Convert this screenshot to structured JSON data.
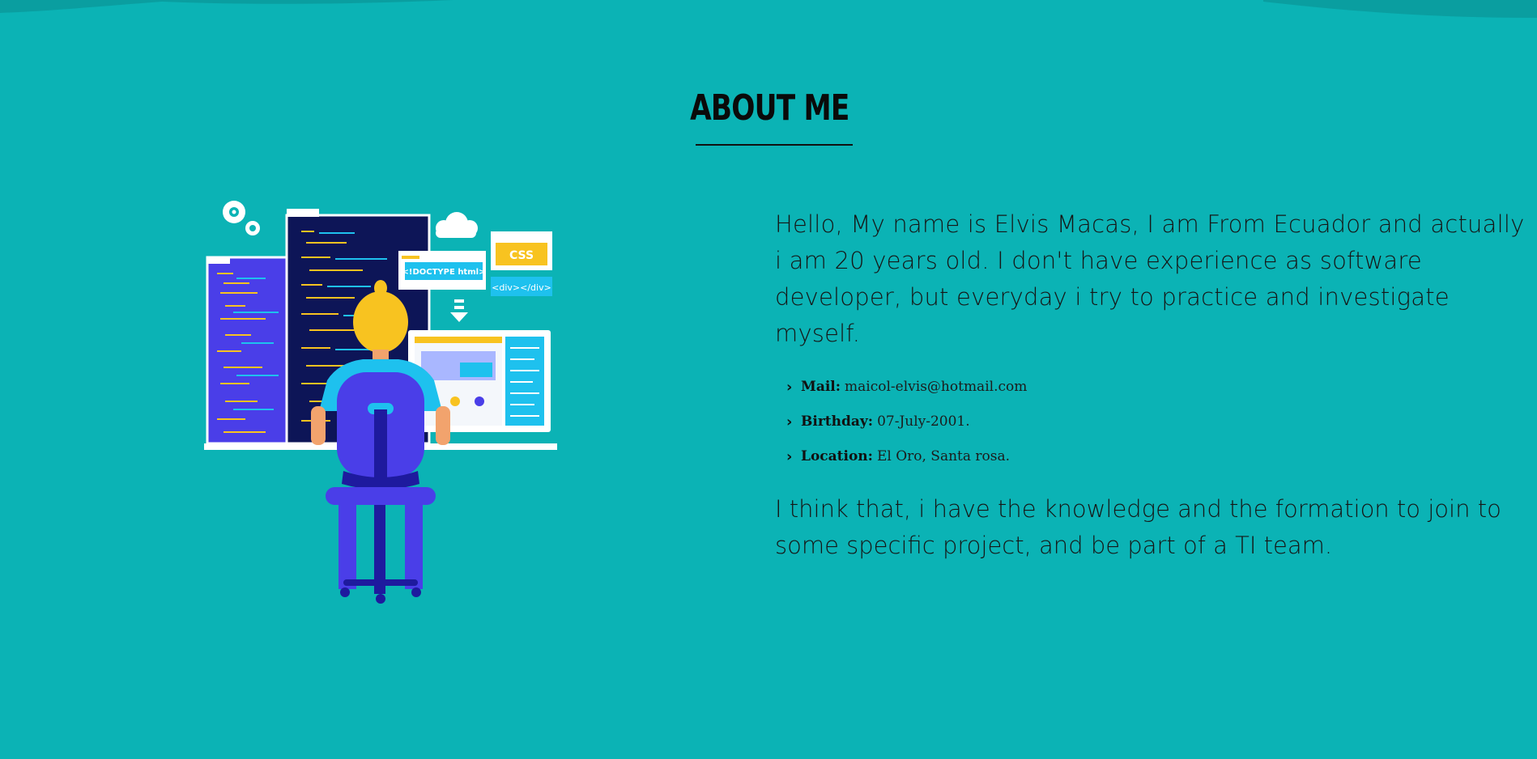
{
  "section": {
    "title": "ABOUT ME"
  },
  "about": {
    "intro": "Hello, My name is Elvis Macas, I am From Ecuador and actually i am 20 years old. I don't have experience as software developer, but everyday i try to practice and investigate myself.",
    "details": [
      {
        "icon": "chevron-right-icon",
        "label": "Mail:",
        "value": "maicol-elvis@hotmail.com"
      },
      {
        "icon": "chevron-right-icon",
        "label": "Birthday:",
        "value": "07-July-2001."
      },
      {
        "icon": "chevron-right-icon",
        "label": "Location:",
        "value": "El Oro, Santa rosa."
      }
    ],
    "closing": "I think that, i have the knowledge and the formation to join to some specific project, and be part of a TI team."
  },
  "illustration": {
    "doctype_label": "<!DOCTYPE html>",
    "css_label": "CSS",
    "div_label": "<div></div>"
  },
  "colors": {
    "background": "#0bb3b5",
    "wave": "#0a9ea0",
    "accent_blue": "#4a3ee8",
    "dark_navy": "#0d1557",
    "hair": "#f8c320",
    "shirt": "#1ec1ee"
  }
}
